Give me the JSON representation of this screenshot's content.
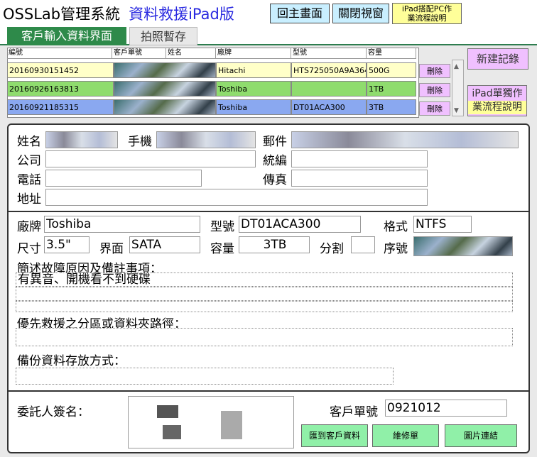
{
  "app": {
    "title": "OSSLab管理系統",
    "subtitle": "資料救援iPad版",
    "home_btn": "回主畫面",
    "close_btn": "關閉視窗",
    "help_btn_line1": "iPad搭配PC作",
    "help_btn_line2": "業流程說明"
  },
  "tabs": [
    {
      "label": "客戶輸入資料界面",
      "active": true
    },
    {
      "label": "拍照暫存",
      "active": false
    }
  ],
  "table": {
    "headers": [
      "編號",
      "客戶單號",
      "姓名",
      "廠牌",
      "型號",
      "容量"
    ],
    "rows": [
      {
        "id": "20160930151452",
        "brand": "Hitachi",
        "model": "HTS725050A9A364",
        "capacity": "500G",
        "delete": "刪除",
        "color": "#ffffc8"
      },
      {
        "id": "20160926163813",
        "brand": "Toshiba",
        "model": "",
        "capacity": "1TB",
        "delete": "刪除",
        "color": "#8fdc6e"
      },
      {
        "id": "20160921185315",
        "brand": "Toshiba",
        "model": "DT01ACA300",
        "capacity": "3TB",
        "delete": "刪除",
        "color": "#8aa8f0"
      }
    ]
  },
  "side": {
    "new_record": "新建記錄",
    "ipad_solo_line1": "iPad單獨作",
    "ipad_solo_line2": "業流程說明"
  },
  "customer": {
    "name_label": "姓名",
    "phone_mobile_label": "手機",
    "email_label": "郵件",
    "company_label": "公司",
    "taxid_label": "統編",
    "tel_label": "電話",
    "fax_label": "傳真",
    "address_label": "地址"
  },
  "device": {
    "brand_label": "廠牌",
    "brand_value": "Toshiba",
    "model_label": "型號",
    "model_value": "DT01ACA300",
    "format_label": "格式",
    "format_value": "NTFS",
    "size_label": "尺寸",
    "size_value": "3.5\"",
    "interface_label": "界面",
    "interface_value": "SATA",
    "capacity_label": "容量",
    "capacity_value": "3TB",
    "partition_label": "分割",
    "partition_value": "",
    "serial_label": "序號"
  },
  "notes": {
    "fault_label": "簡述故障原因及備註事項：",
    "fault_value": "有異音、開機看不到硬碟",
    "priority_label": "優先救援之分區或資料夾路徑：",
    "backup_label": "備份資料存放方式："
  },
  "signature": {
    "sign_label": "委託人簽名：",
    "order_label": "客戶單號",
    "order_value": "0921012",
    "btn_import": "匯到客戶資料",
    "btn_repair": "維修單",
    "btn_image": "圖片連結"
  }
}
